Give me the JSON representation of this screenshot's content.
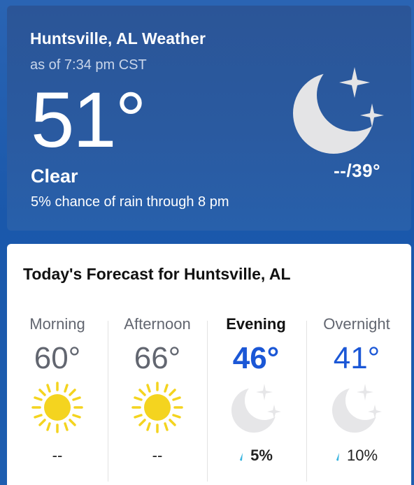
{
  "current": {
    "title": "Huntsville, AL Weather",
    "as_of": "as of 7:34 pm CST",
    "temperature": "51°",
    "phrase": "Clear",
    "precip": "5% chance of rain through 8 pm",
    "hilo": "--/39°",
    "icon": "moon-stars-icon"
  },
  "forecast": {
    "title": "Today's Forecast for Huntsville, AL",
    "periods": [
      {
        "label": "Morning",
        "temp": "60°",
        "icon": "sun-icon",
        "precip": "--"
      },
      {
        "label": "Afternoon",
        "temp": "66°",
        "icon": "sun-icon",
        "precip": "--"
      },
      {
        "label": "Evening",
        "temp": "46°",
        "icon": "moon-stars-icon",
        "precip": "5%"
      },
      {
        "label": "Overnight",
        "temp": "41°",
        "icon": "moon-stars-icon",
        "precip": "10%"
      }
    ]
  },
  "colors": {
    "accent_blue": "#1b57d6",
    "panel_blue": "#2a5aa0",
    "sun": "#f4d41f",
    "moon_gray": "#e4e4e6",
    "drop": "#3bb5e0"
  }
}
